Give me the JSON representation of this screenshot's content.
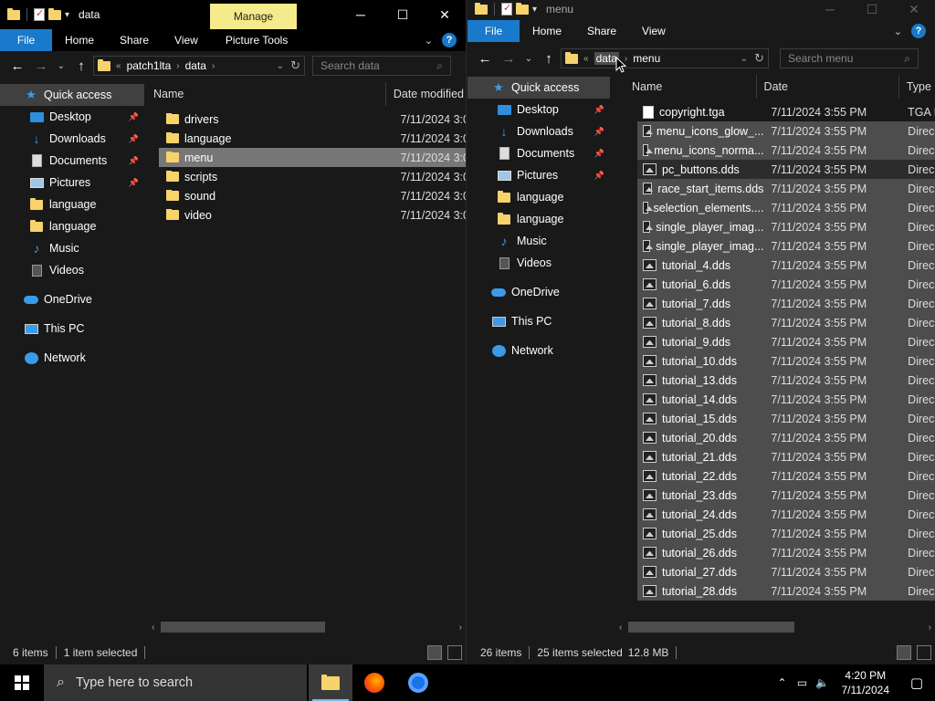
{
  "left": {
    "title": "data",
    "manage_label": "Manage",
    "ribbon_tabs": [
      "File",
      "Home",
      "Share",
      "View",
      "Picture Tools"
    ],
    "path": [
      "patch1lta",
      "data"
    ],
    "search_placeholder": "Search data",
    "sidebar": [
      {
        "label": "Quick access",
        "icon": "star-icon",
        "pinned": false,
        "selected": true
      },
      {
        "label": "Desktop",
        "icon": "desktop-icon",
        "pinned": true
      },
      {
        "label": "Downloads",
        "icon": "downloads-icon",
        "pinned": true
      },
      {
        "label": "Documents",
        "icon": "documents-icon",
        "pinned": true
      },
      {
        "label": "Pictures",
        "icon": "pictures-icon",
        "pinned": true
      },
      {
        "label": "language",
        "icon": "folder-icon"
      },
      {
        "label": "language",
        "icon": "folder-icon"
      },
      {
        "label": "Music",
        "icon": "music-icon"
      },
      {
        "label": "Videos",
        "icon": "videos-icon"
      },
      {
        "label": "OneDrive",
        "icon": "onedrive-icon"
      },
      {
        "label": "This PC",
        "icon": "this-pc-icon"
      },
      {
        "label": "Network",
        "icon": "network-icon"
      }
    ],
    "columns": [
      "Name",
      "Date modified"
    ],
    "files": [
      {
        "name": "drivers",
        "date": "7/11/2024 3:0"
      },
      {
        "name": "language",
        "date": "7/11/2024 3:0"
      },
      {
        "name": "menu",
        "date": "7/11/2024 3:0",
        "selected": true
      },
      {
        "name": "scripts",
        "date": "7/11/2024 3:0"
      },
      {
        "name": "sound",
        "date": "7/11/2024 3:0"
      },
      {
        "name": "video",
        "date": "7/11/2024 3:0"
      }
    ],
    "status": {
      "items": "6 items",
      "selected": "1 item selected"
    }
  },
  "right": {
    "title": "menu",
    "ribbon_tabs": [
      "File",
      "Home",
      "Share",
      "View"
    ],
    "path": [
      "data",
      "menu"
    ],
    "search_placeholder": "Search menu",
    "sidebar": [
      {
        "label": "Quick access",
        "icon": "star-icon",
        "selected": true
      },
      {
        "label": "Desktop",
        "icon": "desktop-icon",
        "pinned": true
      },
      {
        "label": "Downloads",
        "icon": "downloads-icon",
        "pinned": true
      },
      {
        "label": "Documents",
        "icon": "documents-icon",
        "pinned": true
      },
      {
        "label": "Pictures",
        "icon": "pictures-icon",
        "pinned": true
      },
      {
        "label": "language",
        "icon": "folder-icon"
      },
      {
        "label": "language",
        "icon": "folder-icon"
      },
      {
        "label": "Music",
        "icon": "music-icon"
      },
      {
        "label": "Videos",
        "icon": "videos-icon"
      },
      {
        "label": "OneDrive",
        "icon": "onedrive-icon"
      },
      {
        "label": "This PC",
        "icon": "this-pc-icon"
      },
      {
        "label": "Network",
        "icon": "network-icon"
      }
    ],
    "columns": [
      "Name",
      "Date",
      "Type"
    ],
    "files": [
      {
        "name": "copyright.tga",
        "date": "7/11/2024 3:55 PM",
        "type": "TGA I",
        "kind": "file"
      },
      {
        "name": "menu_icons_glow_...",
        "date": "7/11/2024 3:55 PM",
        "type": "Direc",
        "kind": "image",
        "selected": true
      },
      {
        "name": "menu_icons_norma...",
        "date": "7/11/2024 3:55 PM",
        "type": "Direc",
        "kind": "image",
        "selected": true
      },
      {
        "name": "pc_buttons.dds",
        "date": "7/11/2024 3:55 PM",
        "type": "Direc",
        "kind": "image",
        "selected": true,
        "focused": true
      },
      {
        "name": "race_start_items.dds",
        "date": "7/11/2024 3:55 PM",
        "type": "Direc",
        "kind": "image",
        "selected": true
      },
      {
        "name": "selection_elements....",
        "date": "7/11/2024 3:55 PM",
        "type": "Direc",
        "kind": "image",
        "selected": true
      },
      {
        "name": "single_player_imag...",
        "date": "7/11/2024 3:55 PM",
        "type": "Direc",
        "kind": "image",
        "selected": true
      },
      {
        "name": "single_player_imag...",
        "date": "7/11/2024 3:55 PM",
        "type": "Direc",
        "kind": "image",
        "selected": true
      },
      {
        "name": "tutorial_4.dds",
        "date": "7/11/2024 3:55 PM",
        "type": "Direc",
        "kind": "image",
        "selected": true
      },
      {
        "name": "tutorial_6.dds",
        "date": "7/11/2024 3:55 PM",
        "type": "Direc",
        "kind": "image",
        "selected": true
      },
      {
        "name": "tutorial_7.dds",
        "date": "7/11/2024 3:55 PM",
        "type": "Direc",
        "kind": "image",
        "selected": true
      },
      {
        "name": "tutorial_8.dds",
        "date": "7/11/2024 3:55 PM",
        "type": "Direc",
        "kind": "image",
        "selected": true
      },
      {
        "name": "tutorial_9.dds",
        "date": "7/11/2024 3:55 PM",
        "type": "Direc",
        "kind": "image",
        "selected": true
      },
      {
        "name": "tutorial_10.dds",
        "date": "7/11/2024 3:55 PM",
        "type": "Direc",
        "kind": "image",
        "selected": true
      },
      {
        "name": "tutorial_13.dds",
        "date": "7/11/2024 3:55 PM",
        "type": "Direc",
        "kind": "image",
        "selected": true
      },
      {
        "name": "tutorial_14.dds",
        "date": "7/11/2024 3:55 PM",
        "type": "Direc",
        "kind": "image",
        "selected": true
      },
      {
        "name": "tutorial_15.dds",
        "date": "7/11/2024 3:55 PM",
        "type": "Direc",
        "kind": "image",
        "selected": true
      },
      {
        "name": "tutorial_20.dds",
        "date": "7/11/2024 3:55 PM",
        "type": "Direc",
        "kind": "image",
        "selected": true
      },
      {
        "name": "tutorial_21.dds",
        "date": "7/11/2024 3:55 PM",
        "type": "Direc",
        "kind": "image",
        "selected": true
      },
      {
        "name": "tutorial_22.dds",
        "date": "7/11/2024 3:55 PM",
        "type": "Direc",
        "kind": "image",
        "selected": true
      },
      {
        "name": "tutorial_23.dds",
        "date": "7/11/2024 3:55 PM",
        "type": "Direc",
        "kind": "image",
        "selected": true
      },
      {
        "name": "tutorial_24.dds",
        "date": "7/11/2024 3:55 PM",
        "type": "Direc",
        "kind": "image",
        "selected": true
      },
      {
        "name": "tutorial_25.dds",
        "date": "7/11/2024 3:55 PM",
        "type": "Direc",
        "kind": "image",
        "selected": true
      },
      {
        "name": "tutorial_26.dds",
        "date": "7/11/2024 3:55 PM",
        "type": "Direc",
        "kind": "image",
        "selected": true
      },
      {
        "name": "tutorial_27.dds",
        "date": "7/11/2024 3:55 PM",
        "type": "Direc",
        "kind": "image",
        "selected": true
      },
      {
        "name": "tutorial_28.dds",
        "date": "7/11/2024 3:55 PM",
        "type": "Direc",
        "kind": "image",
        "selected": true
      }
    ],
    "status": {
      "items": "26 items",
      "selected": "25 items selected",
      "size": "12.8 MB"
    }
  },
  "taskbar": {
    "search_placeholder": "Type here to search",
    "time": "4:20 PM",
    "date": "7/11/2024"
  },
  "colors": {
    "accent": "#1979ca",
    "manage": "#f6eb8c",
    "folder": "#f6d36b",
    "selection": "#777777"
  }
}
